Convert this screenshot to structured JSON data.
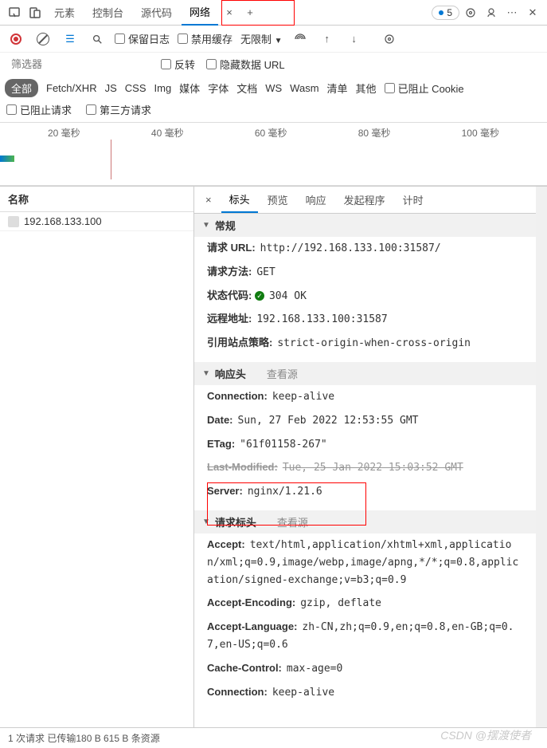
{
  "topTabs": {
    "elements": "元素",
    "console": "控制台",
    "sources": "源代码",
    "network": "网络",
    "issueCount": "5"
  },
  "toolbar": {
    "preserveLog": "保留日志",
    "disableCache": "禁用缓存",
    "noThrottle": "无限制"
  },
  "filter": {
    "placeholder": "筛选器",
    "invert": "反转",
    "hideDataUrls": "隐藏数据 URL"
  },
  "typeFilters": {
    "all": "全部",
    "fetchXhr": "Fetch/XHR",
    "js": "JS",
    "css": "CSS",
    "img": "Img",
    "media": "媒体",
    "font": "字体",
    "doc": "文档",
    "ws": "WS",
    "wasm": "Wasm",
    "manifest": "清单",
    "other": "其他",
    "blockedCookies": "已阻止 Cookie",
    "blockedRequests": "已阻止请求",
    "thirdParty": "第三方请求"
  },
  "timeline": {
    "t1": "20 毫秒",
    "t2": "40 毫秒",
    "t3": "60 毫秒",
    "t4": "80 毫秒",
    "t5": "100 毫秒"
  },
  "leftPane": {
    "header": "名称",
    "request1": "192.168.133.100"
  },
  "detailTabs": {
    "headers": "标头",
    "preview": "预览",
    "response": "响应",
    "initiator": "发起程序",
    "timing": "计时"
  },
  "general": {
    "title": "常规",
    "urlK": "请求 URL:",
    "urlV": "http://192.168.133.100:31587/",
    "methodK": "请求方法:",
    "methodV": "GET",
    "statusK": "状态代码:",
    "statusV": "304 OK",
    "remoteK": "远程地址:",
    "remoteV": "192.168.133.100:31587",
    "referrerK": "引用站点策略:",
    "referrerV": "strict-origin-when-cross-origin"
  },
  "responseHeaders": {
    "title": "响应头",
    "viewSource": "查看源",
    "connK": "Connection:",
    "connV": "keep-alive",
    "dateK": "Date:",
    "dateV": "Sun, 27 Feb 2022 12:53:55 GMT",
    "etagK": "ETag:",
    "etagV": "\"61f01158-267\"",
    "lmK": "Last-Modified:",
    "lmV": "Tue, 25 Jan 2022 15:03:52 GMT",
    "serverK": "Server:",
    "serverV": "nginx/1.21.6"
  },
  "requestHeaders": {
    "title": "请求标头",
    "viewSource": "查看源",
    "acceptK": "Accept:",
    "acceptV": "text/html,application/xhtml+xml,application/xml;q=0.9,image/webp,image/apng,*/*;q=0.8,application/signed-exchange;v=b3;q=0.9",
    "accEncK": "Accept-Encoding:",
    "accEncV": "gzip, deflate",
    "accLangK": "Accept-Language:",
    "accLangV": "zh-CN,zh;q=0.9,en;q=0.8,en-GB;q=0.7,en-US;q=0.6",
    "cacheK": "Cache-Control:",
    "cacheV": "max-age=0",
    "connK": "Connection:",
    "connV": "keep-alive"
  },
  "statusBar": "1 次请求   已传输180 B   615 B 条资源",
  "watermark": "CSDN @摆渡使者"
}
